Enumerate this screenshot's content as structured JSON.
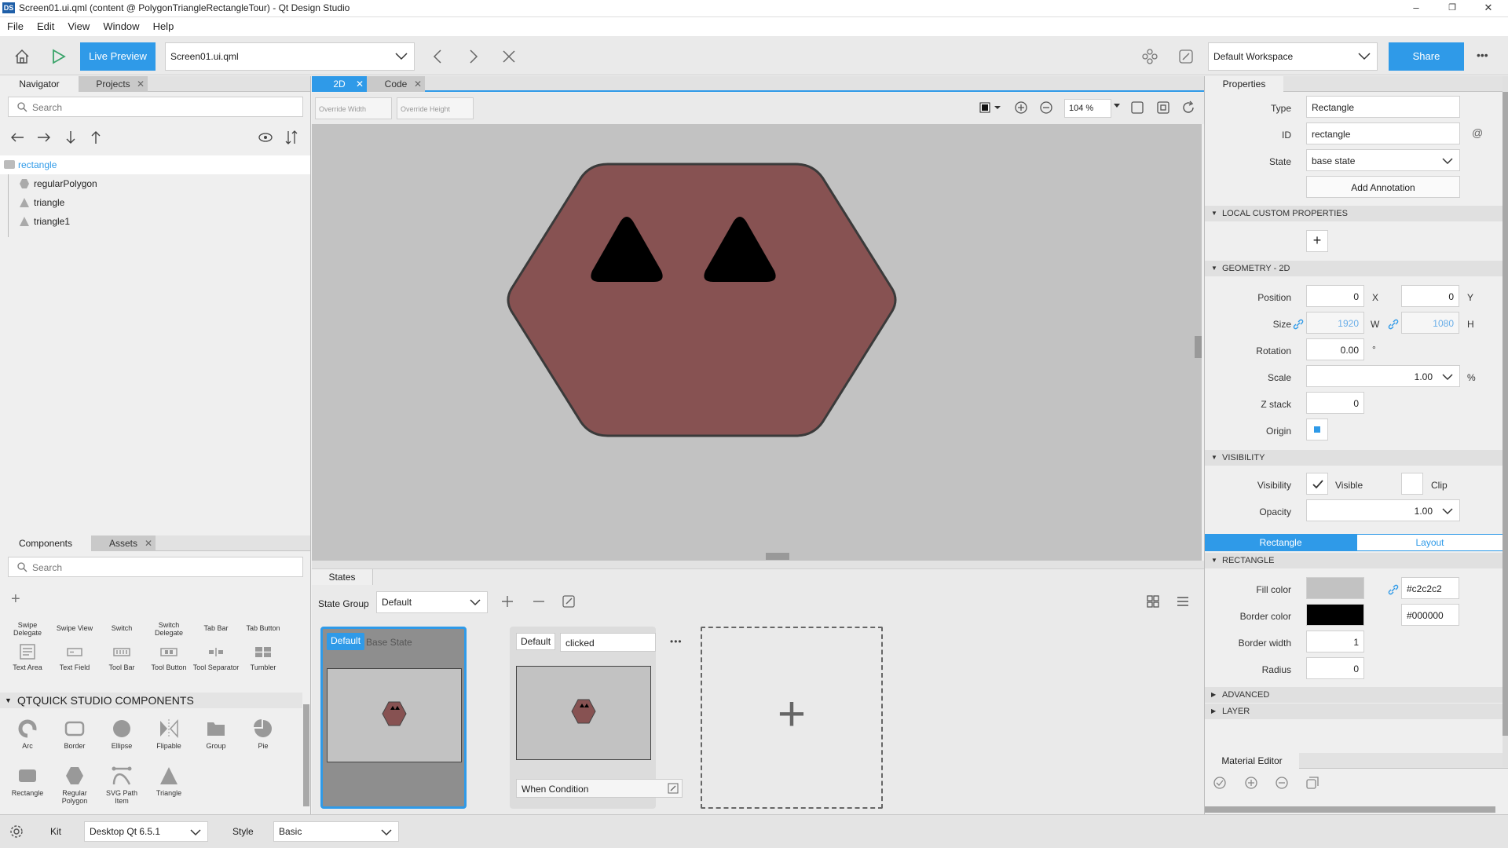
{
  "window": {
    "app_icon": "DS",
    "title": "Screen01.ui.qml (content @ PolygonTriangleRectangleTour) - Qt Design Studio",
    "controls": [
      "–",
      "❐",
      "✕"
    ]
  },
  "menu": [
    "File",
    "Edit",
    "View",
    "Window",
    "Help"
  ],
  "toolbar": {
    "live_preview": "Live Preview",
    "file_combo": "Screen01.ui.qml",
    "workspace": "Default Workspace",
    "share": "Share",
    "more": "•••"
  },
  "navigator": {
    "tabs": [
      "Navigator",
      "Projects"
    ],
    "search_placeholder": "Search",
    "items": [
      {
        "label": "rectangle",
        "icon": "rectangle-icon",
        "selected": true
      },
      {
        "label": "regularPolygon",
        "icon": "polygon-icon"
      },
      {
        "label": "triangle",
        "icon": "triangle-icon"
      },
      {
        "label": "triangle1",
        "icon": "triangle-icon"
      }
    ]
  },
  "components": {
    "tabs": [
      "Components",
      "Assets"
    ],
    "search_placeholder": "Search",
    "controls_row1": [
      "Swipe Delegate",
      "Swipe View",
      "Switch",
      "Switch Delegate",
      "Tab Bar",
      "Tab Button"
    ],
    "controls_row2": [
      "Text Area",
      "Text Field",
      "Tool Bar",
      "Tool Button",
      "Tool Separator",
      "Tumbler"
    ],
    "section_title": "QTQUICK STUDIO COMPONENTS",
    "studio_row1": [
      "Arc",
      "Border",
      "Ellipse",
      "Flipable",
      "Group",
      "Pie"
    ],
    "studio_row2": [
      "Rectangle",
      "Regular Polygon",
      "SVG Path Item",
      "Triangle"
    ]
  },
  "editor": {
    "tabs": [
      "2D",
      "Code"
    ],
    "override_width": "Override Width",
    "override_height": "Override Height",
    "zoom": "104 %"
  },
  "canvas": {
    "background": "#c2c2c2",
    "shape_fill": "#875252",
    "shape_border": "#3a3a3a",
    "eye_color": "#000000"
  },
  "states": {
    "title": "States",
    "group_label": "State Group",
    "group_value": "Default",
    "cards": [
      {
        "badge": "Default",
        "name": "Base State",
        "active": true
      },
      {
        "badge": "Default",
        "name": "clicked",
        "condition": "When Condition",
        "active": false
      }
    ],
    "add_label": "+"
  },
  "properties": {
    "tab": "Properties",
    "type_label": "Type",
    "type_value": "Rectangle",
    "id_label": "ID",
    "id_value": "rectangle",
    "state_label": "State",
    "state_value": "base state",
    "add_annotation": "Add Annotation",
    "local_custom": "LOCAL CUSTOM PROPERTIES",
    "geometry": "GEOMETRY - 2D",
    "position_label": "Position",
    "pos_x": "0",
    "pos_y": "0",
    "size_label": "Size",
    "size_w": "1920",
    "size_h": "1080",
    "rotation_label": "Rotation",
    "rotation": "0.00",
    "scale_label": "Scale",
    "scale": "1.00",
    "zstack_label": "Z stack",
    "zstack": "0",
    "origin_label": "Origin",
    "visibility_hdr": "VISIBILITY",
    "visibility_label": "Visibility",
    "visible_text": "Visible",
    "clip_text": "Clip",
    "opacity_label": "Opacity",
    "opacity": "1.00",
    "subtabs": [
      "Rectangle",
      "Layout"
    ],
    "rectangle_hdr": "RECTANGLE",
    "fill_label": "Fill color",
    "fill_value": "#c2c2c2",
    "border_color_label": "Border color",
    "border_value": "#000000",
    "border_width_label": "Border width",
    "border_width": "1",
    "radius_label": "Radius",
    "radius": "0",
    "advanced": "ADVANCED",
    "layer": "LAYER",
    "material_editor": "Material Editor",
    "axis_x": "X",
    "axis_y": "Y",
    "axis_w": "W",
    "axis_h": "H",
    "degree": "°",
    "percent": "%",
    "at": "@"
  },
  "bottombar": {
    "kit_label": "Kit",
    "kit_value": "Desktop Qt 6.5.1",
    "style_label": "Style",
    "style_value": "Basic"
  }
}
